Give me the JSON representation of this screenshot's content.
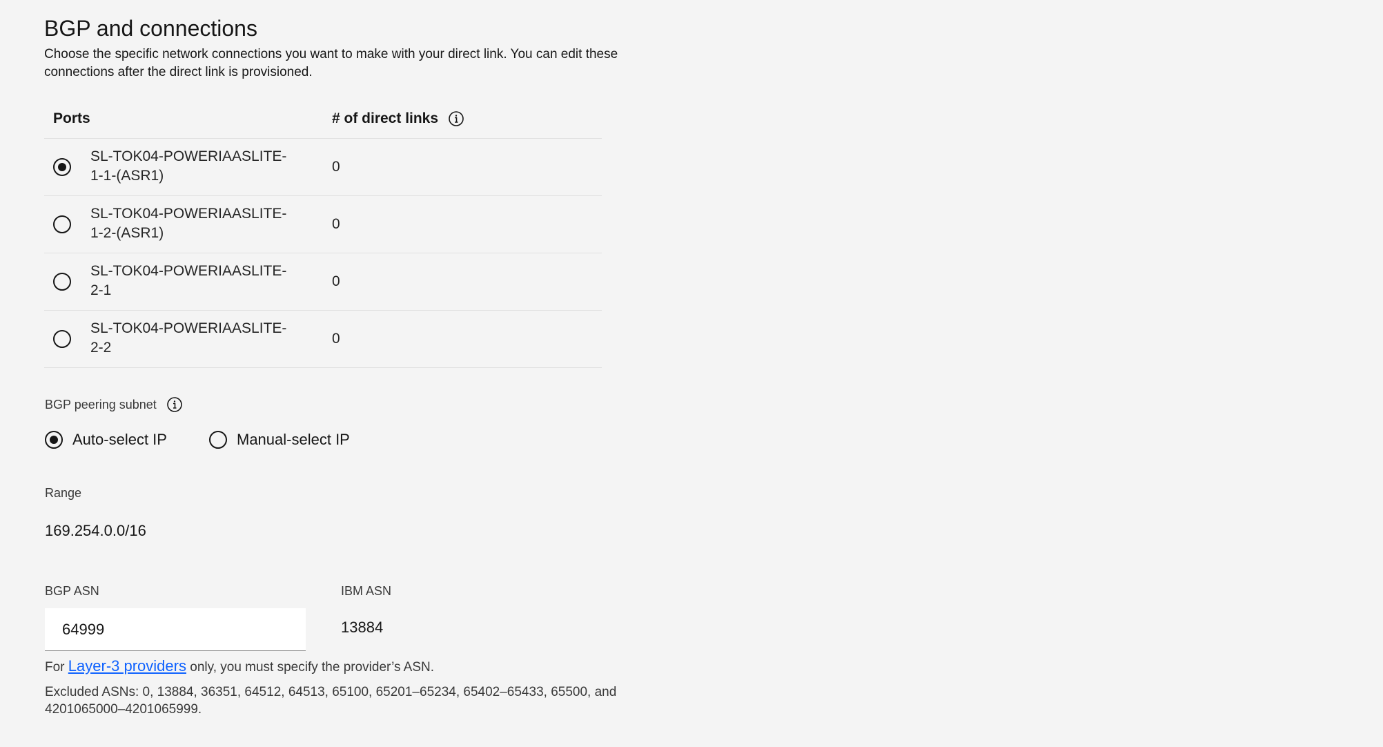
{
  "section": {
    "title": "BGP and connections",
    "description": "Choose the specific network connections you want to make with your direct link. You can edit these connections after the direct link is provisioned."
  },
  "table": {
    "col_ports": "Ports",
    "col_links": "# of direct links",
    "info_icon": "information-icon",
    "rows": [
      {
        "port": "SL-TOK04-POWERIAASLITE-1-1-(ASR1)",
        "links": "0",
        "selected": true
      },
      {
        "port": "SL-TOK04-POWERIAASLITE-1-2-(ASR1)",
        "links": "0",
        "selected": false
      },
      {
        "port": "SL-TOK04-POWERIAASLITE-2-1",
        "links": "0",
        "selected": false
      },
      {
        "port": "SL-TOK04-POWERIAASLITE-2-2",
        "links": "0",
        "selected": false
      }
    ]
  },
  "peering": {
    "label": "BGP peering subnet",
    "auto_label": "Auto-select IP",
    "manual_label": "Manual-select IP",
    "selected": "auto"
  },
  "range": {
    "label": "Range",
    "value": "169.254.0.0/16"
  },
  "asn": {
    "bgp_label": "BGP ASN",
    "bgp_value": "64999",
    "ibm_label": "IBM ASN",
    "ibm_value": "13884",
    "helper_prefix": "For ",
    "helper_link": "Layer-3 providers",
    "helper_suffix": " only, you must specify the provider’s ASN.",
    "excluded": "Excluded ASNs: 0, 13884, 36351, 64512, 64513, 65100, 65201–65234, 65402–65433, 65500, and 4201065000–4201065999."
  },
  "colors": {
    "background": "#f4f4f4",
    "text": "#161616",
    "link": "#0f62fe",
    "divider": "#e0e0e0"
  }
}
